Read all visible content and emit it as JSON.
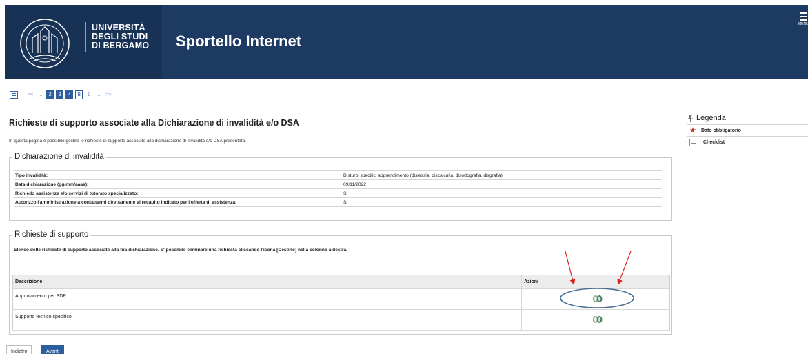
{
  "header": {
    "university_lines": [
      "UNIVERSITÀ",
      "DEGLI STUDI",
      "DI BERGAMO"
    ],
    "app_title": "Sportello Internet",
    "menu_label": "MENU"
  },
  "pager": {
    "first": "<<",
    "ellipsis1": "...",
    "steps": [
      "2",
      "3",
      "4"
    ],
    "current": "B",
    "next": "1",
    "ellipsis2": "...",
    "last": ">>"
  },
  "page": {
    "title": "Richieste di supporto associate alla Dichiarazione di invalidità e/o DSA",
    "intro": "In questa pagina è possibile gestire le richieste di supporto associate alla dichiarazione di invalidità e/o DSA presentata."
  },
  "declaration": {
    "legend": "Dichiarazione di invalidità",
    "rows": [
      {
        "label": "Tipo invalidità:",
        "value": "Disturbi specifici apprendimento (dislessia, discalculia, disortografia, disgrafia)"
      },
      {
        "label": "Data dichiarazione (gg/mm/aaaa):",
        "value": "09/11/2022"
      },
      {
        "label": "Richiedo assistenza e/o servizi di tutorato specializzato:",
        "value": "Si"
      },
      {
        "label": "Autorizzo l'amministrazione a contattarmi direttamente al recapito indicato per l'offerta di assistenza:",
        "value": "Si"
      }
    ]
  },
  "requests": {
    "legend": "Richieste di supporto",
    "intro": "Elenco delle richieste di supporto associate alla tua dichiarazione. E' possibile eliminare una richiesta cliccando l'icona [Cestino] nella colonna a destra.",
    "columns": [
      "Descrizione",
      "Azioni"
    ],
    "rows": [
      {
        "description": "Appuntamento per PDP",
        "action_icon": "trash-icon"
      },
      {
        "description": "Supporto tecnico specifico",
        "action_icon": "trash-icon"
      }
    ]
  },
  "buttons": {
    "back": "Indietro",
    "next": "Avanti"
  },
  "legenda": {
    "title": "Legenda",
    "items": [
      {
        "icon": "star-icon",
        "label": "Dato obbligatorio"
      },
      {
        "icon": "checklist-icon",
        "label": "Checklist"
      }
    ]
  },
  "colors": {
    "header_bg": "#1d3a63",
    "primary": "#2d5e9e",
    "annotation_arrow": "#e02020",
    "annotation_ellipse": "#4a6f95"
  }
}
